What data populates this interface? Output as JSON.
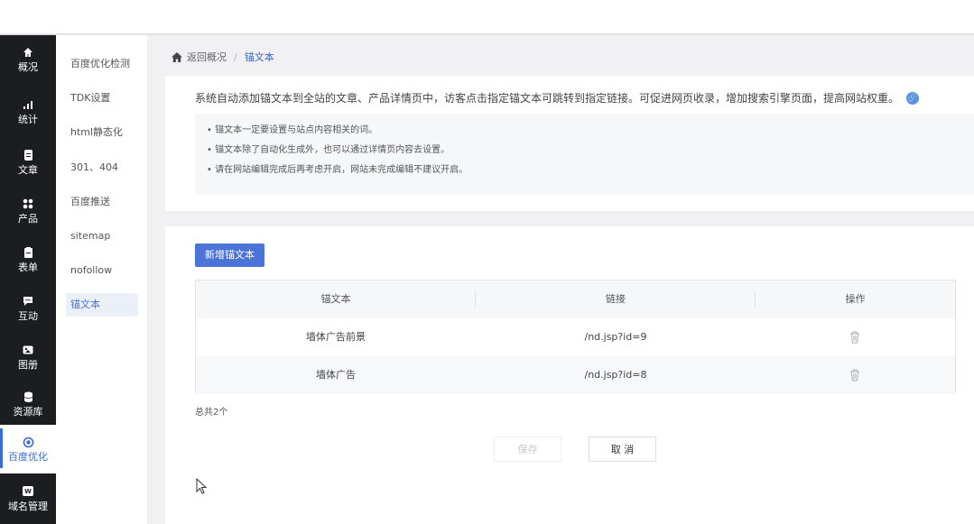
{
  "sidebar": {
    "items": [
      {
        "label": "概况",
        "icon": "home-icon"
      },
      {
        "label": "统计",
        "icon": "stats-icon"
      },
      {
        "label": "文章",
        "icon": "article-icon"
      },
      {
        "label": "产品",
        "icon": "grid-icon"
      },
      {
        "label": "表单",
        "icon": "form-icon"
      },
      {
        "label": "互动",
        "icon": "chat-icon"
      },
      {
        "label": "图册",
        "icon": "album-icon"
      },
      {
        "label": "资源库",
        "icon": "database-icon"
      },
      {
        "label": "百度优化",
        "icon": "target-icon"
      },
      {
        "label": "域名管理",
        "icon": "domain-icon"
      }
    ],
    "active_index": 8
  },
  "submenu": {
    "items": [
      "百度优化检测",
      "TDK设置",
      "html静态化",
      "301、404",
      "百度推送",
      "sitemap",
      "nofollow",
      "锚文本"
    ],
    "active_index": 7
  },
  "breadcrumb": {
    "back": "返回概况",
    "separator": "/",
    "current": "锚文本"
  },
  "intro": {
    "description": "系统自动添加锚文本到全站的文章、产品详情页中，访客点击指定锚文本可跳转到指定链接。可促进网页收录，增加搜索引擎页面，提高网站权重。",
    "tips": [
      "• 锚文本一定要设置与站点内容相关的词。",
      "• 锚文本除了自动化生成外，也可以通过详情页内容去设置。",
      "• 请在网站编辑完成后再考虑开启，网站未完成编辑不建议开启。"
    ]
  },
  "toolbar": {
    "add_label": "新增锚文本"
  },
  "table": {
    "headers": [
      "锚文本",
      "链接",
      "操作"
    ],
    "rows": [
      {
        "anchor": "墙体广告前景",
        "link": "/nd.jsp?id=9"
      },
      {
        "anchor": "墙体广告",
        "link": "/nd.jsp?id=8"
      }
    ]
  },
  "footer": {
    "total": "总共2个",
    "save_label": "保存",
    "cancel_label": "取 消"
  },
  "colors": {
    "accent": "#4c74d8",
    "sidebar_bg": "#1c1d21",
    "page_bg": "#f1f1f4"
  }
}
